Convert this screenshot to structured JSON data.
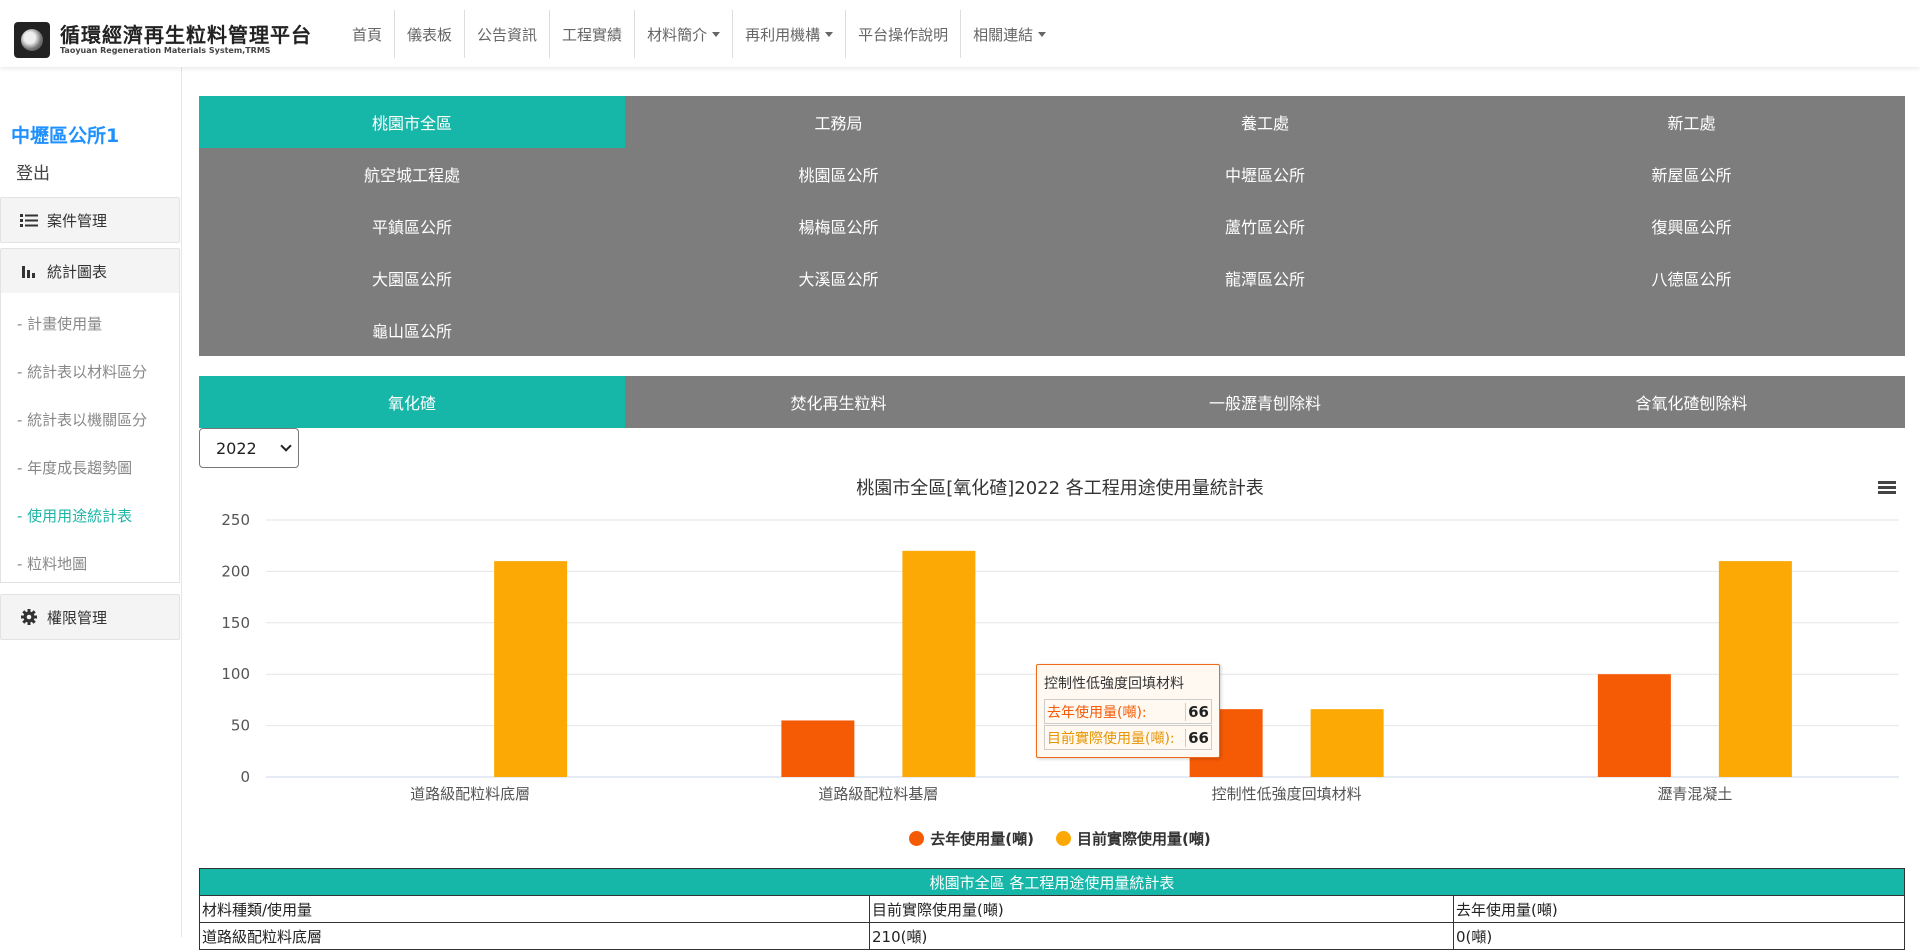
{
  "header": {
    "logo_title": "循環經濟再生粒料管理平台",
    "logo_subtitle": "Taoyuan Regeneration Materials System,TRMS",
    "nav": [
      {
        "label": "首頁",
        "dropdown": false
      },
      {
        "label": "儀表板",
        "dropdown": false
      },
      {
        "label": "公告資訊",
        "dropdown": false
      },
      {
        "label": "工程實績",
        "dropdown": false
      },
      {
        "label": "材料簡介",
        "dropdown": true
      },
      {
        "label": "再利用機構",
        "dropdown": true
      },
      {
        "label": "平台操作說明",
        "dropdown": false
      },
      {
        "label": "相關連結",
        "dropdown": true
      }
    ]
  },
  "sidebar": {
    "user": "中壢區公所1",
    "logout": "登出",
    "groups": [
      {
        "label": "案件管理",
        "icon": "list-icon"
      },
      {
        "label": "統計圖表",
        "icon": "bar-chart-icon"
      },
      {
        "label": "權限管理",
        "icon": "gear-icon"
      }
    ],
    "links": [
      {
        "label": "- 計畫使用量",
        "active": false
      },
      {
        "label": "- 統計表以材料區分",
        "active": false
      },
      {
        "label": "- 統計表以機關區分",
        "active": false
      },
      {
        "label": "- 年度成長趨勢圖",
        "active": false
      },
      {
        "label": "- 使用用途統計表",
        "active": true
      },
      {
        "label": "- 粒料地圖",
        "active": false
      }
    ]
  },
  "agency_tabs": [
    {
      "label": "桃園市全區",
      "active": true
    },
    {
      "label": "工務局",
      "active": false
    },
    {
      "label": "養工處",
      "active": false
    },
    {
      "label": "新工處",
      "active": false
    },
    {
      "label": "航空城工程處",
      "active": false
    },
    {
      "label": "桃園區公所",
      "active": false
    },
    {
      "label": "中壢區公所",
      "active": false
    },
    {
      "label": "新屋區公所",
      "active": false
    },
    {
      "label": "平鎮區公所",
      "active": false
    },
    {
      "label": "楊梅區公所",
      "active": false
    },
    {
      "label": "蘆竹區公所",
      "active": false
    },
    {
      "label": "復興區公所",
      "active": false
    },
    {
      "label": "大園區公所",
      "active": false
    },
    {
      "label": "大溪區公所",
      "active": false
    },
    {
      "label": "龍潭區公所",
      "active": false
    },
    {
      "label": "八德區公所",
      "active": false
    },
    {
      "label": "龜山區公所",
      "active": false
    }
  ],
  "material_tabs": [
    {
      "label": "氧化碴",
      "active": true
    },
    {
      "label": "焚化再生粒料",
      "active": false
    },
    {
      "label": "一般瀝青刨除料",
      "active": false
    },
    {
      "label": "含氧化碴刨除料",
      "active": false
    }
  ],
  "year_select": {
    "value": "2022"
  },
  "colors": {
    "accent": "#16b6a8",
    "tab_bg": "#7d7d7d",
    "series_last_year": "#f55a05",
    "series_current": "#fca905"
  },
  "chart_data": {
    "type": "bar",
    "title": "桃園市全區[氧化碴]2022 各工程用途使用量統計表",
    "categories": [
      "道路級配粒料底層",
      "道路級配粒料基層",
      "控制性低強度回填材料",
      "瀝青混凝土"
    ],
    "series": [
      {
        "name": "去年使用量(噸)",
        "values": [
          0,
          55,
          66,
          100
        ]
      },
      {
        "name": "目前實際使用量(噸)",
        "values": [
          210,
          220,
          66,
          210
        ]
      }
    ],
    "ylim": [
      0,
      250
    ],
    "yticks": [
      0,
      50,
      100,
      150,
      200,
      250
    ],
    "grid": true,
    "legend": "bottom-center"
  },
  "tooltip": {
    "title": "控制性低強度回填材料",
    "rows": [
      {
        "label": "去年使用量(噸):",
        "value": "66"
      },
      {
        "label": "目前實際使用量(噸):",
        "value": "66"
      }
    ]
  },
  "table": {
    "caption": "桃園市全區 各工程用途使用量統計表",
    "headers": [
      "材料種類/使用量",
      "目前實際使用量(噸)",
      "去年使用量(噸)"
    ],
    "rows": [
      [
        "道路級配粒料底層",
        "210(噸)",
        "0(噸)"
      ]
    ]
  }
}
